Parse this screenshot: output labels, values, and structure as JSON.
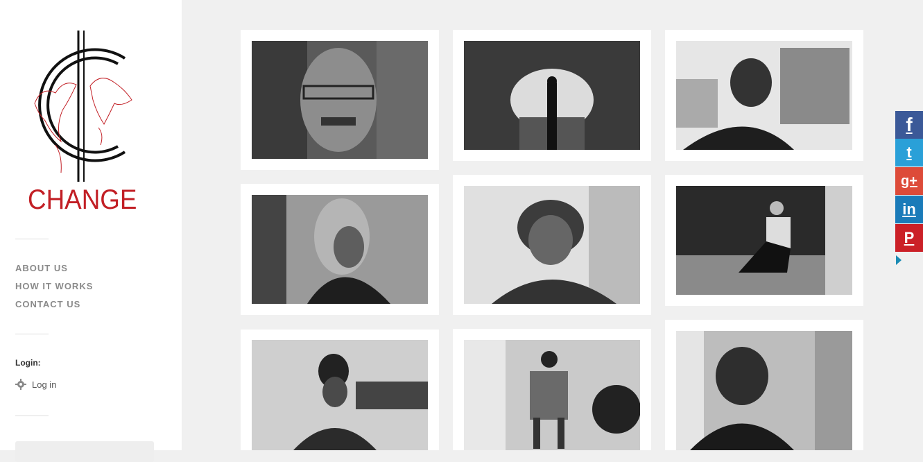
{
  "brand": {
    "name": "CHANGE"
  },
  "nav": {
    "items": [
      {
        "label": "ABOUT US"
      },
      {
        "label": "HOW IT WORKS"
      },
      {
        "label": "CONTACT US"
      }
    ]
  },
  "login": {
    "title": "Login:",
    "link_label": "Log in",
    "icon": "gear-icon"
  },
  "gallery": {
    "photos": [
      {
        "subject": "older man with glasses"
      },
      {
        "subject": "person under lattice tunnel"
      },
      {
        "subject": "young man in city"
      },
      {
        "subject": "young woman in hood"
      },
      {
        "subject": "young woman with bangs"
      },
      {
        "subject": "man seated on street at night"
      },
      {
        "subject": "woman in classroom"
      },
      {
        "subject": "boy seated in room"
      },
      {
        "subject": "boy in hallway"
      }
    ]
  },
  "social": {
    "buttons": [
      {
        "glyph": "f",
        "icon": "facebook-icon",
        "color": "#3b5998"
      },
      {
        "glyph": "t",
        "icon": "twitter-icon",
        "color": "#2aa0d8"
      },
      {
        "glyph": "g+",
        "icon": "google-plus-icon",
        "color": "#dd4b39"
      },
      {
        "glyph": "in",
        "icon": "linkedin-icon",
        "color": "#1a7bb9"
      },
      {
        "glyph": "P",
        "icon": "pinterest-icon",
        "color": "#cb2027"
      }
    ]
  },
  "colors": {
    "brand_red": "#c21f25",
    "background": "#f0f0f0"
  }
}
